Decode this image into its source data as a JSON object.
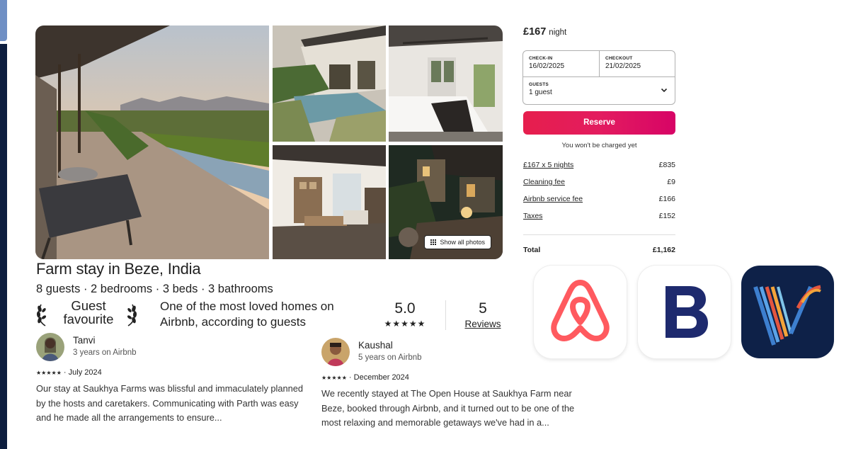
{
  "listing": {
    "title": "Farm stay in Beze, India",
    "summary": "8 guests · 2 bedrooms · 3 beds · 3 bathrooms",
    "show_all_photos": "Show all photos",
    "photos": [
      "pool-veranda-photo",
      "garden-pool-photo",
      "bedroom-photo",
      "living-room-photo",
      "evening-courtyard-photo"
    ]
  },
  "highlights": {
    "badge_line1": "Guest",
    "badge_line2": "favourite",
    "loved_text": "One of the most loved homes on Airbnb, according to guests",
    "rating": "5.0",
    "stars": "★★★★★",
    "reviews_count": "5",
    "reviews_label": "Reviews"
  },
  "reviews": [
    {
      "name": "Tanvi",
      "tenure": "3 years on Airbnb",
      "stars": "★★★★★",
      "date": "· July 2024",
      "text": "Our stay at Saukhya Farms was blissful and immaculately planned by the hosts and caretakers. Communicating with Parth was easy and he made all the arrangements to ensure..."
    },
    {
      "name": "Kaushal",
      "tenure": "5 years on Airbnb",
      "stars": "★★★★★",
      "date": "· December 2024",
      "text": "We recently stayed at The Open House at Saukhya Farm near Beze, booked through Airbnb, and it turned out to be one of the most relaxing and memorable getaways we've had in a..."
    }
  ],
  "booking": {
    "price": "£167",
    "price_unit": "night",
    "checkin_label": "CHECK-IN",
    "checkin_value": "16/02/2025",
    "checkout_label": "CHECKOUT",
    "checkout_value": "21/02/2025",
    "guests_label": "GUESTS",
    "guests_value": "1 guest",
    "reserve_label": "Reserve",
    "no_charge_note": "You won't be charged yet",
    "fees": [
      {
        "label": "£167 x 5 nights",
        "amount": "£835"
      },
      {
        "label": "Cleaning fee",
        "amount": "£9"
      },
      {
        "label": "Airbnb service fee",
        "amount": "£166"
      },
      {
        "label": "Taxes",
        "amount": "£152"
      }
    ],
    "total_label": "Total",
    "total_amount": "£1,162"
  },
  "apps": [
    {
      "name": "Airbnb",
      "icon": "airbnb-logo-icon",
      "color": "#ff5a5f"
    },
    {
      "name": "Booking.com",
      "icon": "booking-logo-icon",
      "color": "#1e2a6e"
    },
    {
      "name": "Vrbo",
      "icon": "vrbo-logo-icon",
      "color": "#0e2148"
    }
  ],
  "colors": {
    "reserve_start": "#e61e4d",
    "reserve_end": "#d70466",
    "sidebar": "#0d1e3f"
  }
}
